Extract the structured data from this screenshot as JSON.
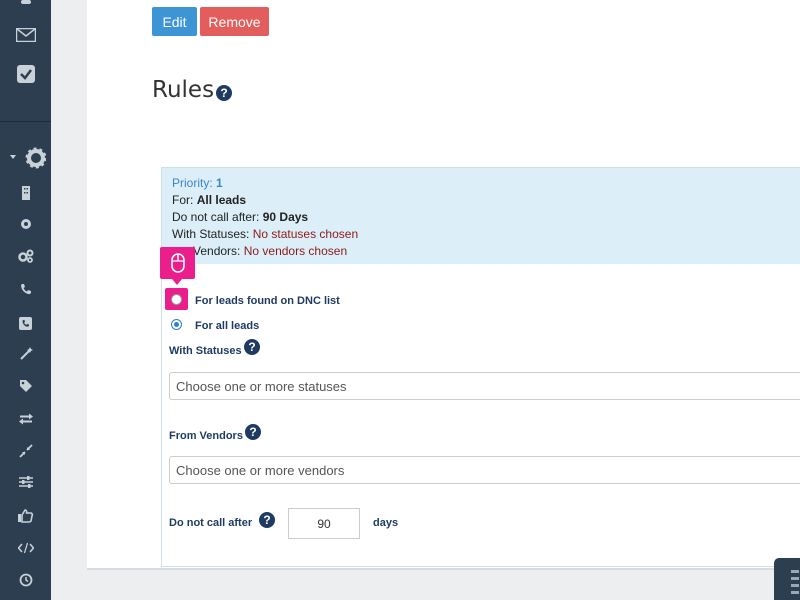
{
  "sidebar": {
    "icons": [
      "mail-icon",
      "checkbox-icon",
      "settings-gear-icon",
      "building-icon",
      "cog-icon",
      "cogs-icon",
      "phone-icon",
      "phone-square-icon",
      "magic-wand-icon",
      "tag-icon",
      "exchange-icon",
      "compress-icon",
      "sliders-icon",
      "thumbs-up-icon",
      "code-icon",
      "clock-icon"
    ]
  },
  "toolbar": {
    "edit_label": "Edit",
    "remove_label": "Remove"
  },
  "rules": {
    "title": "Rules",
    "help_glyph": "?",
    "summary": {
      "priority_label": "Priority:",
      "priority_value": "1",
      "for_label": "For:",
      "for_value": "All leads",
      "dnc_label": "Do not call after:",
      "dnc_value": "90 Days",
      "statuses_label": "With Statuses:",
      "statuses_value": "No statuses chosen",
      "vendors_label": "n Vendors:",
      "vendors_value": "No vendors chosen"
    },
    "form": {
      "option_dnc": "For leads found on DNC list",
      "option_all": "For all leads",
      "with_statuses_label": "With Statuses",
      "statuses_placeholder": "Choose one or more statuses",
      "from_vendors_label": "From Vendors",
      "vendors_placeholder": "Choose one or more vendors",
      "do_not_call_after_label": "Do not call after",
      "days_value": "90",
      "days_unit": "days"
    }
  },
  "colors": {
    "sidebar": "#2c3e50",
    "edit": "#3d95d6",
    "remove": "#e45d5d",
    "highlight": "#ea1f8c",
    "info_bg": "#dceff9"
  }
}
